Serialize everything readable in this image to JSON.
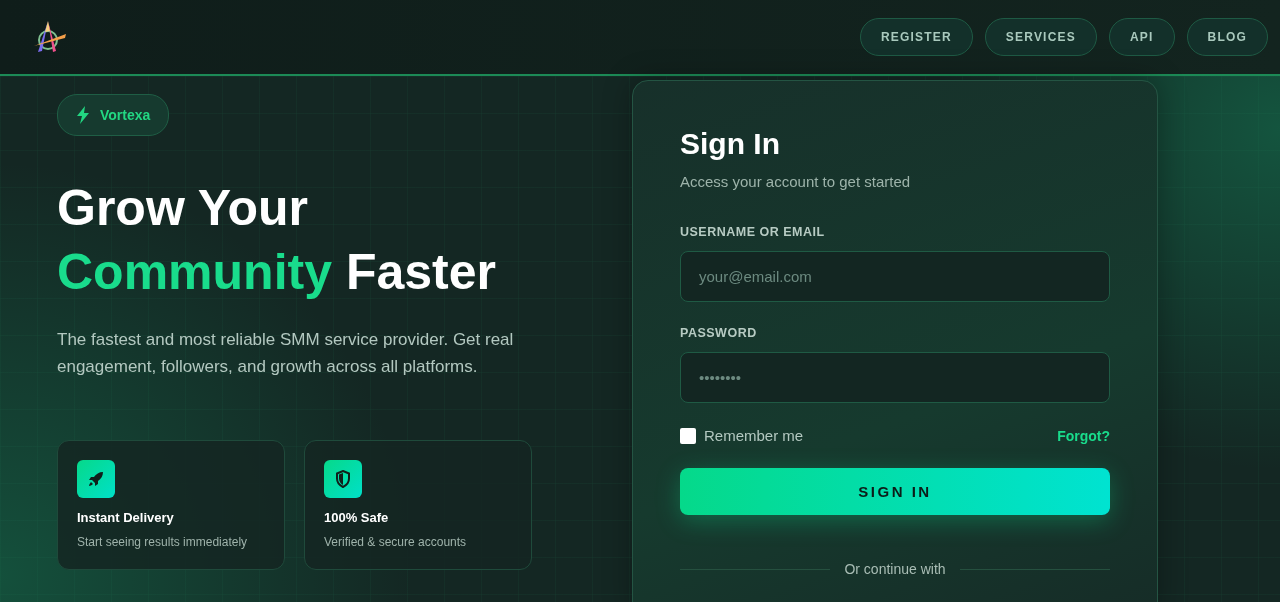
{
  "nav": [
    {
      "label": "REGISTER"
    },
    {
      "label": "SERVICES"
    },
    {
      "label": "API"
    },
    {
      "label": "BLOG"
    }
  ],
  "badge": "Vortexa",
  "headline": {
    "line1": "Grow Your",
    "highlight": "Community",
    "rest": "Faster"
  },
  "subtitle": "The fastest and most reliable SMM service provider. Get real engagement, followers, and growth across all platforms.",
  "features": [
    {
      "kind": "rocket",
      "title": "Instant Delivery",
      "text": "Start seeing results immediately"
    },
    {
      "kind": "shield",
      "title": "100% Safe",
      "text": "Verified & secure accounts"
    }
  ],
  "signin": {
    "title": "Sign In",
    "subtitle": "Access your account to get started",
    "username_label": "USERNAME OR EMAIL",
    "username_placeholder": "your@email.com",
    "password_label": "PASSWORD",
    "password_placeholder": "••••••••",
    "remember": {
      "label": "Remember me",
      "checked": false
    },
    "forgot": "Forgot?",
    "button": "SIGN IN",
    "divider": "Or continue with"
  }
}
